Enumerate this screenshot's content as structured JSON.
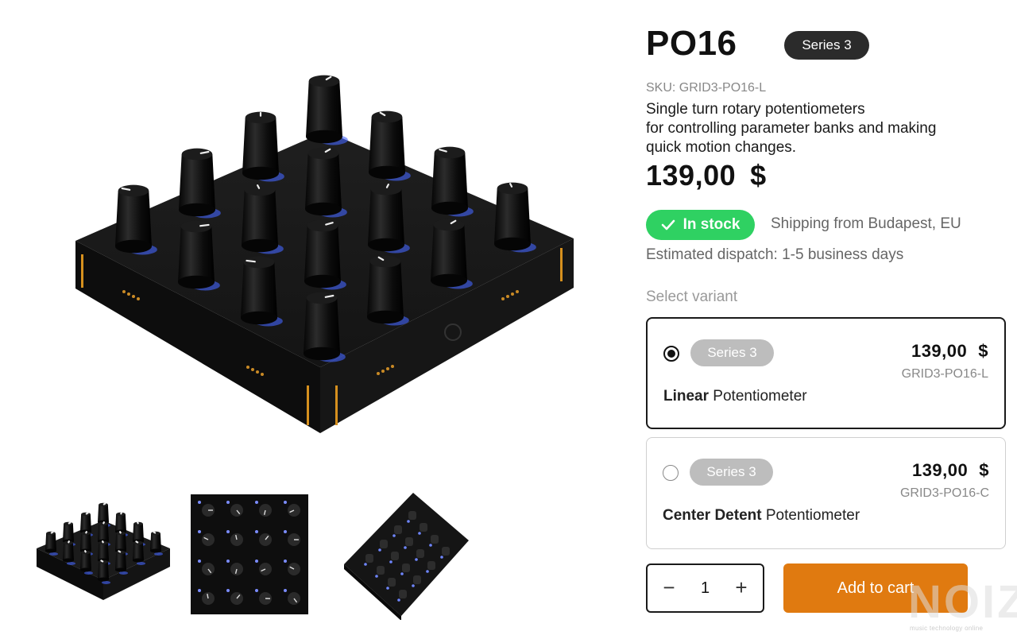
{
  "product": {
    "title": "PO16",
    "series_badge": "Series 3",
    "sku": "SKU: GRID3-PO16-L",
    "description_lines": [
      "Single turn rotary potentiometers",
      "for controlling parameter banks and making",
      "quick motion changes."
    ],
    "price_amount": "139,00",
    "price_currency": "$"
  },
  "availability": {
    "stock_label": "In stock",
    "stock_color": "#2fd162",
    "shipping": "Shipping from Budapest, EU",
    "dispatch": "Estimated dispatch: 1-5 business days"
  },
  "variants": {
    "label": "Select variant",
    "items": [
      {
        "series": "Series 3",
        "price_amount": "139,00",
        "price_currency": "$",
        "sku": "GRID3-PO16-L",
        "name_bold": "Linear",
        "name_rest": " Potentiometer",
        "selected": true
      },
      {
        "series": "Series 3",
        "price_amount": "139,00",
        "price_currency": "$",
        "sku": "GRID3-PO16-C",
        "name_bold": "Center Detent",
        "name_rest": " Potentiometer",
        "selected": false
      }
    ]
  },
  "cart": {
    "quantity": "1",
    "minus_icon": "minus-icon",
    "plus_icon": "plus-icon",
    "add_label": "Add to cart",
    "button_color": "#e07a10"
  },
  "gallery": {
    "hero_icon": "product-photo",
    "thumbnails": [
      "thumbnail-front",
      "thumbnail-top",
      "thumbnail-angled"
    ]
  },
  "watermark": {
    "big": "NOIZ",
    "small": "music technology online"
  }
}
